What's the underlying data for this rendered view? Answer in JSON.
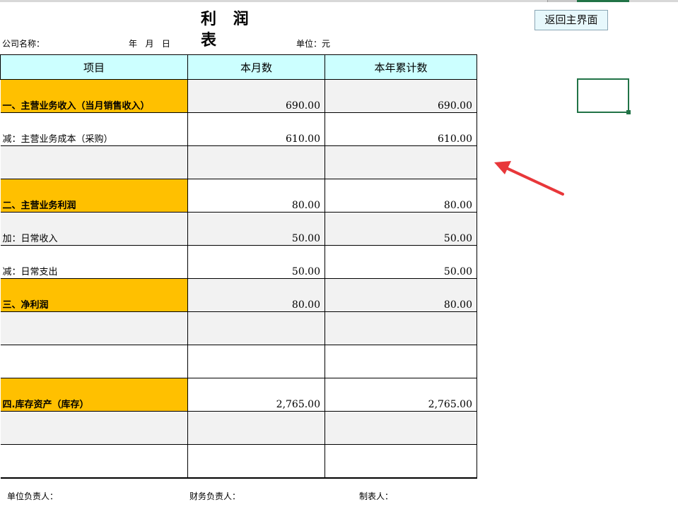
{
  "sheet": {
    "title": "利 润 表",
    "return_button": "返回主界面",
    "company_label": "公司名称：",
    "date_label": "年   月   日",
    "unit_label": "单位：元"
  },
  "table": {
    "headers": [
      "项目",
      "本月数",
      "本年累计数"
    ],
    "rows": [
      {
        "item": "一、主营业务收入（当月销售收入）",
        "month": "690.00",
        "ytd": "690.00"
      },
      {
        "item": "减：主营业务成本（采购）",
        "month": "610.00",
        "ytd": "610.00"
      },
      {
        "item": "",
        "month": "",
        "ytd": ""
      },
      {
        "item": "二、主营业务利润",
        "month": "80.00",
        "ytd": "80.00"
      },
      {
        "item": "加：日常收入",
        "month": "50.00",
        "ytd": "50.00"
      },
      {
        "item": "减：日常支出",
        "month": "50.00",
        "ytd": "50.00"
      },
      {
        "item": "三、净利润",
        "month": "80.00",
        "ytd": "80.00"
      },
      {
        "item": "",
        "month": "",
        "ytd": ""
      },
      {
        "item": "",
        "month": "",
        "ytd": ""
      },
      {
        "item": "四.库存资产（库存）",
        "month": "2,765.00",
        "ytd": "2,765.00"
      },
      {
        "item": "",
        "month": "",
        "ytd": ""
      },
      {
        "item": "",
        "month": "",
        "ytd": ""
      }
    ]
  },
  "footer": {
    "unit_head": "单位负责人：",
    "finance_head": "财务负责人：",
    "preparer": "制表人："
  },
  "colors": {
    "header_fill": "#ccffff",
    "category_fill": "#ffc000",
    "alt_row_fill": "#f2f2f2",
    "selection": "#217346",
    "arrow": "#e8373a"
  },
  "annotation": {
    "icon": "red-arrow-icon"
  }
}
